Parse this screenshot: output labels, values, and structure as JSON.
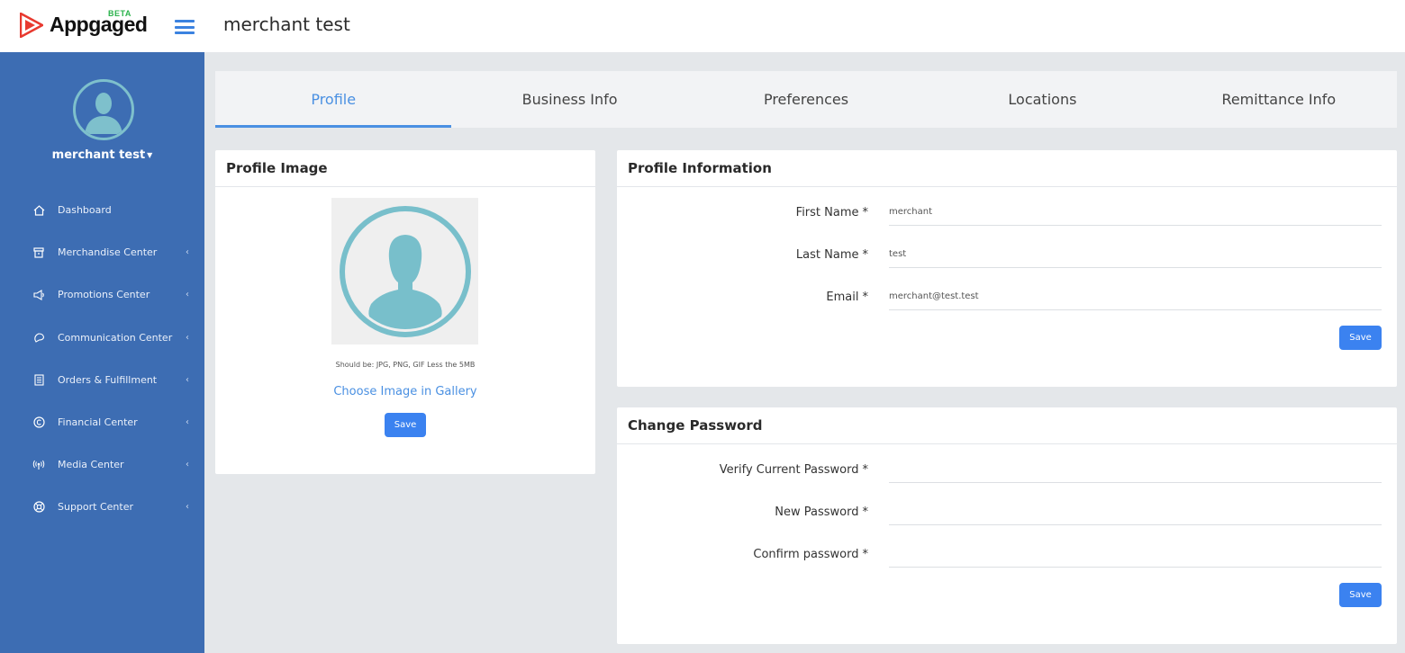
{
  "app": {
    "logo_text": "Appgaged",
    "logo_badge": "BETA",
    "page_title": "merchant test",
    "brand_color": "#3d6db3",
    "accent_color": "#4a90e2"
  },
  "sidebar": {
    "username": "merchant test",
    "items": [
      {
        "label": "Dashboard",
        "icon": "home-icon",
        "has_submenu": false
      },
      {
        "label": "Merchandise Center",
        "icon": "store-icon",
        "has_submenu": true
      },
      {
        "label": "Promotions Center",
        "icon": "megaphone-icon",
        "has_submenu": true
      },
      {
        "label": "Communication Center",
        "icon": "chat-icon",
        "has_submenu": true
      },
      {
        "label": "Orders & Fulfillment",
        "icon": "document-icon",
        "has_submenu": true
      },
      {
        "label": "Financial Center",
        "icon": "copyright-icon",
        "has_submenu": true
      },
      {
        "label": "Media Center",
        "icon": "broadcast-icon",
        "has_submenu": true
      },
      {
        "label": "Support Center",
        "icon": "lifebuoy-icon",
        "has_submenu": true
      }
    ]
  },
  "tabs": [
    {
      "label": "Profile",
      "active": true
    },
    {
      "label": "Business Info",
      "active": false
    },
    {
      "label": "Preferences",
      "active": false
    },
    {
      "label": "Locations",
      "active": false
    },
    {
      "label": "Remittance Info",
      "active": false
    }
  ],
  "profile_image": {
    "title": "Profile Image",
    "hint": "Should be: JPG, PNG, GIF Less the 5MB",
    "choose_link": "Choose Image in Gallery",
    "save_label": "Save"
  },
  "profile_info": {
    "title": "Profile Information",
    "fields": [
      {
        "label": "First Name",
        "required": "*",
        "value": "merchant"
      },
      {
        "label": "Last Name",
        "required": "*",
        "value": "test"
      },
      {
        "label": "Email",
        "required": "*",
        "value": "merchant@test.test"
      }
    ],
    "save_label": "Save"
  },
  "change_password": {
    "title": "Change Password",
    "fields": [
      {
        "label": "Verify Current Password",
        "required": "*",
        "value": ""
      },
      {
        "label": "New Password",
        "required": "*",
        "value": ""
      },
      {
        "label": "Confirm password",
        "required": "*",
        "value": ""
      }
    ],
    "save_label": "Save"
  }
}
